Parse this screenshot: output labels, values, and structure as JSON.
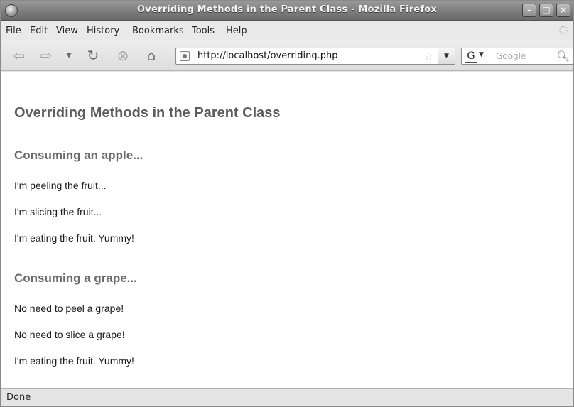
{
  "window": {
    "title": "Overriding Methods in the Parent Class - Mozilla Firefox",
    "controls": {
      "minimize": "–",
      "maximize": "□",
      "close": "×"
    }
  },
  "menu": {
    "items": [
      {
        "label": "File"
      },
      {
        "label": "Edit"
      },
      {
        "label": "View"
      },
      {
        "label": "History"
      },
      {
        "label": "Bookmarks"
      },
      {
        "label": "Tools"
      },
      {
        "label": "Help"
      }
    ]
  },
  "toolbar": {
    "icons": {
      "back": "back-arrow-icon",
      "forward": "forward-arrow-icon",
      "history_drop": "dropdown-icon",
      "reload": "reload-icon",
      "stop": "stop-icon",
      "home": "home-icon"
    },
    "glyphs": {
      "back": "⇦",
      "forward": "⇨",
      "drop": "▾",
      "reload": "↻",
      "stop": "⊗",
      "home": "⌂"
    },
    "address": {
      "value": "http://localhost/overriding.php"
    },
    "search": {
      "engine": "G",
      "placeholder": "Google"
    }
  },
  "page": {
    "heading": "Overriding Methods in the Parent Class",
    "sections": [
      {
        "title": "Consuming an apple...",
        "lines": [
          "I'm peeling the fruit...",
          "I'm slicing the fruit...",
          "I'm eating the fruit. Yummy!"
        ]
      },
      {
        "title": "Consuming a grape...",
        "lines": [
          "No need to peel a grape!",
          "No need to slice a grape!",
          "I'm eating the fruit. Yummy!"
        ]
      }
    ]
  },
  "status": {
    "text": "Done"
  },
  "colors": {
    "titlebar": "#7d7d7d",
    "heading": "#5d5d5d",
    "body_text": "#1a1a1a"
  }
}
